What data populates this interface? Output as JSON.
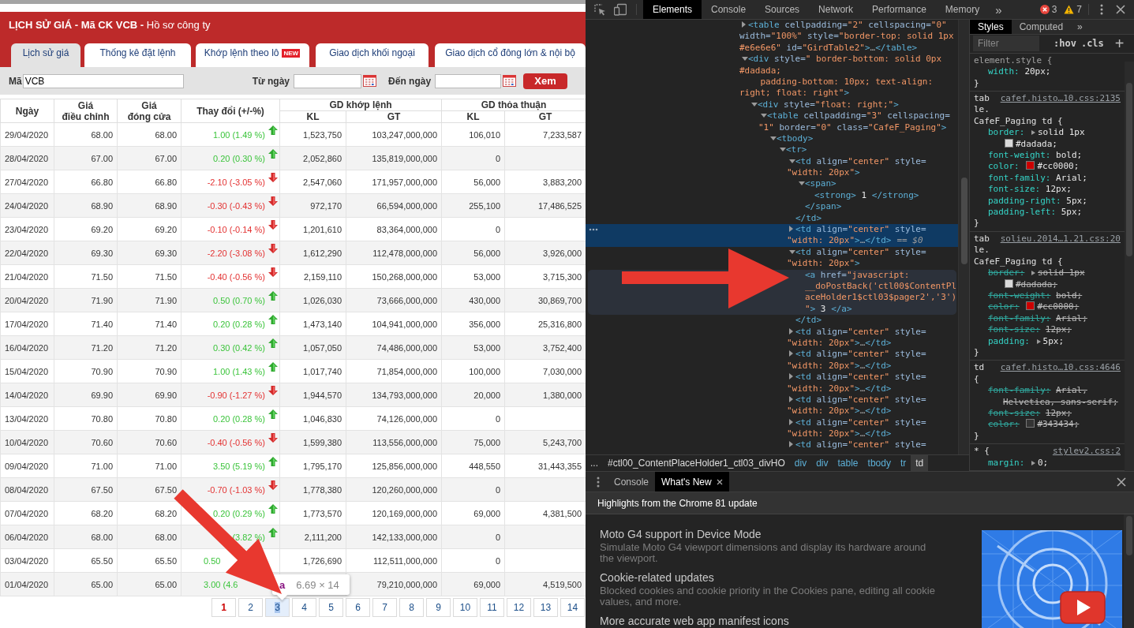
{
  "page": {
    "title": "**LỊCH SỬ GIÁ - Mã CK VCB -** Hồ sơ công ty",
    "tabs": [
      {
        "label": "Lịch sử giá",
        "selected": true
      },
      {
        "label": "Thống kê đặt lệnh",
        "selected": false
      },
      {
        "label": "Khớp lệnh theo lô",
        "selected": false,
        "badge": "NEW"
      },
      {
        "label": "Giao dịch khối ngoại",
        "selected": false
      },
      {
        "label": "Giao dịch cổ đông lớn & nội bộ",
        "selected": false
      }
    ],
    "filter": {
      "code_label": "Mã",
      "code_value": "VCB",
      "from_label": "Từ ngày",
      "to_label": "Đến ngày",
      "button": "Xem"
    },
    "table": {
      "columns": [
        {
          "lines": [
            "Ngày"
          ]
        },
        {
          "lines": [
            "Giá",
            "điều chỉnh"
          ]
        },
        {
          "lines": [
            "Giá",
            "đóng cửa"
          ]
        },
        {
          "lines": [
            "Thay đổi (+/-%)"
          ]
        }
      ],
      "groups": [
        {
          "label": "GD khớp lệnh",
          "sub": [
            "KL",
            "GT"
          ]
        },
        {
          "label": "GD thỏa thuận",
          "sub": [
            "KL",
            "GT"
          ]
        }
      ],
      "rows": [
        {
          "date": "29/04/2020",
          "adjusted": "68.00",
          "close": "68.00",
          "change": "1.00 (1.49 %)",
          "rising": true,
          "covered_end": false,
          "match_kl": "1,523,750",
          "match_gt": "103,247,000,000",
          "deal_kl": "106,010",
          "deal_gt": "7,233,587"
        },
        {
          "date": "28/04/2020",
          "adjusted": "67.00",
          "close": "67.00",
          "change": "0.20 (0.30 %)",
          "rising": true,
          "covered_end": false,
          "match_kl": "2,052,860",
          "match_gt": "135,819,000,000",
          "deal_kl": "0"
        },
        {
          "date": "27/04/2020",
          "adjusted": "66.80",
          "close": "66.80",
          "change": "-2.10 (-3.05 %)",
          "rising": false,
          "covered_end": false,
          "match_kl": "2,547,060",
          "match_gt": "171,957,000,000",
          "deal_kl": "56,000",
          "deal_gt": "3,883,200"
        },
        {
          "date": "24/04/2020",
          "adjusted": "68.90",
          "close": "68.90",
          "change": "-0.30 (-0.43 %)",
          "rising": false,
          "covered_end": false,
          "match_kl": "972,170",
          "match_gt": "66,594,000,000",
          "deal_kl": "255,100",
          "deal_gt": "17,486,525"
        },
        {
          "date": "23/04/2020",
          "adjusted": "69.20",
          "close": "69.20",
          "change": "-0.10 (-0.14 %)",
          "rising": false,
          "covered_end": false,
          "match_kl": "1,201,610",
          "match_gt": "83,364,000,000",
          "deal_kl": "0"
        },
        {
          "date": "22/04/2020",
          "adjusted": "69.30",
          "close": "69.30",
          "change": "-2.20 (-3.08 %)",
          "rising": false,
          "covered_end": false,
          "match_kl": "1,612,290",
          "match_gt": "112,478,000,000",
          "deal_kl": "56,000",
          "deal_gt": "3,926,000"
        },
        {
          "date": "21/04/2020",
          "adjusted": "71.50",
          "close": "71.50",
          "change": "-0.40 (-0.56 %)",
          "rising": false,
          "covered_end": false,
          "match_kl": "2,159,110",
          "match_gt": "150,268,000,000",
          "deal_kl": "53,000",
          "deal_gt": "3,715,300"
        },
        {
          "date": "20/04/2020",
          "adjusted": "71.90",
          "close": "71.90",
          "change": "0.50 (0.70 %)",
          "rising": true,
          "covered_end": false,
          "match_kl": "1,026,030",
          "match_gt": "73,666,000,000",
          "deal_kl": "430,000",
          "deal_gt": "30,869,700"
        },
        {
          "date": "17/04/2020",
          "adjusted": "71.40",
          "close": "71.40",
          "change": "0.20 (0.28 %)",
          "rising": true,
          "covered_end": false,
          "match_kl": "1,473,140",
          "match_gt": "104,941,000,000",
          "deal_kl": "356,000",
          "deal_gt": "25,316,800"
        },
        {
          "date": "16/04/2020",
          "adjusted": "71.20",
          "close": "71.20",
          "change": "0.30 (0.42 %)",
          "rising": true,
          "covered_end": false,
          "match_kl": "1,057,050",
          "match_gt": "74,486,000,000",
          "deal_kl": "53,000",
          "deal_gt": "3,752,400"
        },
        {
          "date": "15/04/2020",
          "adjusted": "70.90",
          "close": "70.90",
          "change": "1.00 (1.43 %)",
          "rising": true,
          "covered_end": false,
          "match_kl": "1,017,740",
          "match_gt": "71,854,000,000",
          "deal_kl": "100,000",
          "deal_gt": "7,030,000"
        },
        {
          "date": "14/04/2020",
          "adjusted": "69.90",
          "close": "69.90",
          "change": "-0.90 (-1.27 %)",
          "rising": false,
          "covered_end": false,
          "match_kl": "1,944,570",
          "match_gt": "134,793,000,000",
          "deal_kl": "20,000",
          "deal_gt": "1,380,000"
        },
        {
          "date": "13/04/2020",
          "adjusted": "70.80",
          "close": "70.80",
          "change": "0.20 (0.28 %)",
          "rising": true,
          "covered_end": false,
          "match_kl": "1,046,830",
          "match_gt": "74,126,000,000",
          "deal_kl": "0"
        },
        {
          "date": "10/04/2020",
          "adjusted": "70.60",
          "close": "70.60",
          "change": "-0.40 (-0.56 %)",
          "rising": false,
          "covered_end": false,
          "match_kl": "1,599,380",
          "match_gt": "113,556,000,000",
          "deal_kl": "75,000",
          "deal_gt": "5,243,700"
        },
        {
          "date": "09/04/2020",
          "adjusted": "71.00",
          "close": "71.00",
          "change": "3.50 (5.19 %)",
          "rising": true,
          "covered_end": false,
          "match_kl": "1,795,170",
          "match_gt": "125,856,000,000",
          "deal_kl": "448,550",
          "deal_gt": "31,443,355"
        },
        {
          "date": "08/04/2020",
          "adjusted": "67.50",
          "close": "67.50",
          "change": "-0.70 (-1.03 %)",
          "rising": false,
          "covered_end": false,
          "match_kl": "1,778,380",
          "match_gt": "120,260,000,000",
          "deal_kl": "0"
        },
        {
          "date": "07/04/2020",
          "adjusted": "68.20",
          "close": "68.20",
          "change": "0.20 (0.29 %)",
          "rising": true,
          "covered_end": false,
          "match_kl": "1,773,570",
          "match_gt": "120,169,000,000",
          "deal_kl": "69,000",
          "deal_gt": "4,381,500"
        },
        {
          "date": "06/04/2020",
          "adjusted": "68.00",
          "close": "68.00",
          "change": "(3.82 %)",
          "rising": true,
          "covered_end": false,
          "match_kl": "2,111,200",
          "match_gt": "142,133,000,000",
          "deal_kl": "0"
        },
        {
          "date": "03/04/2020",
          "adjusted": "65.50",
          "close": "65.50",
          "change": "0.50",
          "rising": true,
          "covered_end": true,
          "match_kl": "1,726,690",
          "match_gt": "112,511,000,000",
          "deal_kl": "0"
        },
        {
          "date": "01/04/2020",
          "adjusted": "65.00",
          "close": "65.00",
          "change": "3.00 (4.6",
          "rising": true,
          "covered_end": true,
          "match_gt": "79,210,000,000",
          "deal_kl": "69,000",
          "deal_gt": "4,519,500"
        }
      ]
    },
    "pager": {
      "pages": [
        {
          "label": "1",
          "current": true,
          "highlighted": false
        },
        {
          "label": "2",
          "current": false,
          "highlighted": false
        },
        {
          "label": "3",
          "current": false,
          "highlighted": true
        },
        {
          "label": "4",
          "current": false,
          "highlighted": false
        },
        {
          "label": "5",
          "current": false,
          "highlighted": false
        },
        {
          "label": "6",
          "current": false,
          "highlighted": false
        },
        {
          "label": "7",
          "current": false,
          "highlighted": false
        },
        {
          "label": "8",
          "current": false,
          "highlighted": false
        },
        {
          "label": "9",
          "current": false,
          "highlighted": false
        },
        {
          "label": "10",
          "current": false,
          "highlighted": false
        },
        {
          "label": "11",
          "current": false,
          "highlighted": false
        },
        {
          "label": "12",
          "current": false,
          "highlighted": false
        },
        {
          "label": "13",
          "current": false,
          "highlighted": false
        },
        {
          "label": "14",
          "current": false,
          "highlighted": false
        }
      ]
    },
    "tooltip": {
      "tag": "a",
      "size": "6.69 × 14"
    }
  },
  "devtools": {
    "tabs": [
      {
        "label": "Elements",
        "selected": true
      },
      {
        "label": "Console",
        "selected": false
      },
      {
        "label": "Sources",
        "selected": false
      },
      {
        "label": "Network",
        "selected": false
      },
      {
        "label": "Performance",
        "selected": false
      },
      {
        "label": "Memory",
        "selected": false
      }
    ],
    "more": "»",
    "errors": "3",
    "warnings": "7",
    "elements": {
      "nodes": [
        {
          "lines": [
            "<table cellpadding=\"2\" cellspacing=\"0\"",
            "width=\"100%\" style=\"border-top: solid 1px",
            "#e6e6e6\" id=\"GirdTable2\">…</table>"
          ],
          "expanded": false,
          "selected": false,
          "hovered": false
        },
        {
          "lines": [
            "<div style=\" border-bottom: solid 0px",
            "#dadada;",
            "    padding-bottom: 10px; text-align:",
            "right; float: right\">"
          ],
          "expanded": true,
          "selected": false,
          "hovered": false,
          "children": [
            {
              "lines": [
                "<div style=\"float: right;\">"
              ],
              "expanded": true,
              "selected": false,
              "hovered": false,
              "children": [
                {
                  "lines": [
                    "<table cellpadding=\"3\" cellspacing=",
                    "\"1\" border=\"0\" class=\"CafeF_Paging\">"
                  ],
                  "expanded": true,
                  "selected": false,
                  "hovered": false,
                  "children": [
                    {
                      "lines": [
                        "<tbody>"
                      ],
                      "expanded": true,
                      "selected": false,
                      "hovered": false,
                      "children": [
                        {
                          "lines": [
                            "<tr>"
                          ],
                          "expanded": true,
                          "selected": false,
                          "hovered": false,
                          "children": [
                            {
                              "lines": [
                                "<td align=\"center\" style=",
                                "\"width: 20px\">"
                              ],
                              "expanded": true,
                              "selected": false,
                              "hovered": false,
                              "close": "</td>",
                              "children": [
                                {
                                  "lines": [
                                    "<span>"
                                  ],
                                  "expanded": true,
                                  "selected": false,
                                  "hovered": false,
                                  "close": "</span>",
                                  "children": [
                                    {
                                      "lines": [
                                        "<strong> 1 </strong>"
                                      ],
                                      "selected": false,
                                      "hovered": false
                                    }
                                  ]
                                }
                              ]
                            },
                            {
                              "lines": [
                                "<td align=\"center\" style=",
                                "\"width: 20px\">…</td>"
                              ],
                              "expanded": false,
                              "selected": true,
                              "hovered": false,
                              "suffix": "== $0"
                            },
                            {
                              "lines": [
                                "<td align=\"center\" style=",
                                "\"width: 20px\">"
                              ],
                              "expanded": true,
                              "selected": false,
                              "hovered": false,
                              "close": "</td>",
                              "children": [
                                {
                                  "lines": [
                                    "<a href=\"javascript:",
                                    "__doPostBack('ctl00$ContentPl",
                                    "aceHolder1$ctl03$pager2','3')",
                                    "\"> 3 </a>"
                                  ],
                                  "selected": false,
                                  "hovered": true
                                }
                              ]
                            },
                            {
                              "lines": [
                                "<td align=\"center\" style=",
                                "\"width: 20px\">…</td>"
                              ],
                              "expanded": false,
                              "selected": false,
                              "hovered": false
                            },
                            {
                              "lines": [
                                "<td align=\"center\" style=",
                                "\"width: 20px\">…</td>"
                              ],
                              "expanded": false,
                              "selected": false,
                              "hovered": false
                            },
                            {
                              "lines": [
                                "<td align=\"center\" style=",
                                "\"width: 20px\">…</td>"
                              ],
                              "expanded": false,
                              "selected": false,
                              "hovered": false
                            },
                            {
                              "lines": [
                                "<td align=\"center\" style=",
                                "\"width: 20px\">…</td>"
                              ],
                              "expanded": false,
                              "selected": false,
                              "hovered": false
                            },
                            {
                              "lines": [
                                "<td align=\"center\" style=",
                                "\"width: 20px\">…</td>"
                              ],
                              "expanded": false,
                              "selected": false,
                              "hovered": false
                            },
                            {
                              "lines": [
                                "<td align=\"center\" style="
                              ],
                              "expanded": false,
                              "selected": false,
                              "hovered": false
                            }
                          ]
                        }
                      ]
                    }
                  ]
                }
              ]
            }
          ]
        }
      ]
    },
    "breadcrumb": [
      {
        "label": "...",
        "kind": "more",
        "selected": false
      },
      {
        "label": "#ctl00_ContentPlaceHolder1_ctl03_divHO",
        "kind": "id",
        "selected": false
      },
      {
        "label": "div",
        "kind": "tag",
        "selected": false
      },
      {
        "label": "div",
        "kind": "tag",
        "selected": false
      },
      {
        "label": "table",
        "kind": "tag",
        "selected": false
      },
      {
        "label": "tbody",
        "kind": "tag",
        "selected": false
      },
      {
        "label": "tr",
        "kind": "tag",
        "selected": false
      },
      {
        "label": "td",
        "kind": "tag",
        "selected": true
      }
    ],
    "styles": {
      "tabs": [
        {
          "label": "Styles",
          "selected": true
        },
        {
          "label": "Computed",
          "selected": false
        }
      ],
      "more": "»",
      "filter_placeholder": "Filter",
      "hov": ":hov",
      "cls": ".cls",
      "add": "+",
      "rules": [
        {
          "kind": "inline",
          "selector_lines": [
            "element.style {"
          ],
          "props": [
            {
              "name": "width:",
              "value_lines": [
                "20px;"
              ],
              "struck": false
            }
          ],
          "close": "}"
        },
        {
          "kind": "rule",
          "selector_lines": [
            "tab",
            "le.",
            "CafeF_Paging td {"
          ],
          "source": "cafef.histo…10.css:2135",
          "props": [
            {
              "name": "border:",
              "expandable": true,
              "value_lines": [
                "solid 1px"
              ],
              "swatch": {
                "color": "#dadada",
                "text": "#dadada;"
              },
              "struck": false
            },
            {
              "name": "font-weight:",
              "value_lines": [
                "bold;"
              ],
              "struck": false
            },
            {
              "name": "color:",
              "swatch": {
                "color": "#cc0000",
                "text": "#cc0000;"
              },
              "struck": false
            },
            {
              "name": "font-family:",
              "value_lines": [
                "Arial;"
              ],
              "struck": false
            },
            {
              "name": "font-size:",
              "value_lines": [
                "12px;"
              ],
              "struck": false
            },
            {
              "name": "padding-right:",
              "value_lines": [
                "5px;"
              ],
              "struck": false
            },
            {
              "name": "padding-left:",
              "value_lines": [
                "5px;"
              ],
              "struck": false
            }
          ],
          "close": "}"
        },
        {
          "kind": "rule",
          "selector_lines": [
            "tab",
            "le.",
            "CafeF_Paging td {"
          ],
          "source": "solieu.2014…1.21.css:20",
          "props": [
            {
              "name": "border:",
              "expandable": true,
              "value_lines": [
                "solid 1px"
              ],
              "swatch": {
                "color": "#dadada",
                "text": "#dadada;"
              },
              "struck": true
            },
            {
              "name": "font-weight:",
              "value_lines": [
                "bold;"
              ],
              "struck": true
            },
            {
              "name": "color:",
              "swatch": {
                "color": "#cc0000",
                "text": "#cc0000;"
              },
              "struck": true
            },
            {
              "name": "font-family:",
              "value_lines": [
                "Arial;"
              ],
              "struck": true
            },
            {
              "name": "font-size:",
              "value_lines": [
                "12px;"
              ],
              "struck": true
            },
            {
              "name": "padding:",
              "expandable": true,
              "value_lines": [
                "5px;"
              ],
              "struck": false
            }
          ],
          "close": "}"
        },
        {
          "kind": "rule",
          "selector_lines": [
            "td",
            "{"
          ],
          "source": "cafef.histo…10.css:4646",
          "props": [
            {
              "name": "font-family:",
              "value_lines": [
                "Arial,",
                "Helvetica, sans-serif;"
              ],
              "struck": true
            },
            {
              "name": "font-size:",
              "value_lines": [
                "12px;"
              ],
              "struck": true
            },
            {
              "name": "color:",
              "swatch": {
                "color": "#343434",
                "text": "#343434;"
              },
              "struck": true
            }
          ],
          "close": "}"
        },
        {
          "kind": "rule",
          "selector_lines": [
            "* {"
          ],
          "source": "stylev2.css:2",
          "props": [
            {
              "name": "margin:",
              "expandable": true,
              "value_lines": [
                "0;"
              ],
              "struck": false
            }
          ]
        }
      ]
    },
    "drawer": {
      "tabs": [
        {
          "label": "Console",
          "selected": false
        },
        {
          "label": "What's New",
          "selected": true,
          "closable": true
        }
      ],
      "heading": "Highlights from the Chrome 81 update",
      "items": [
        {
          "title": "Moto G4 support in Device Mode",
          "description": "Simulate Moto G4 viewport dimensions and display its hardware around the viewport."
        },
        {
          "title": "Cookie-related updates",
          "description": "Blocked cookies and cookie priority in the Cookies pane, editing all cookie values, and more."
        },
        {
          "title": "More accurate web app manifest icons"
        }
      ]
    }
  }
}
